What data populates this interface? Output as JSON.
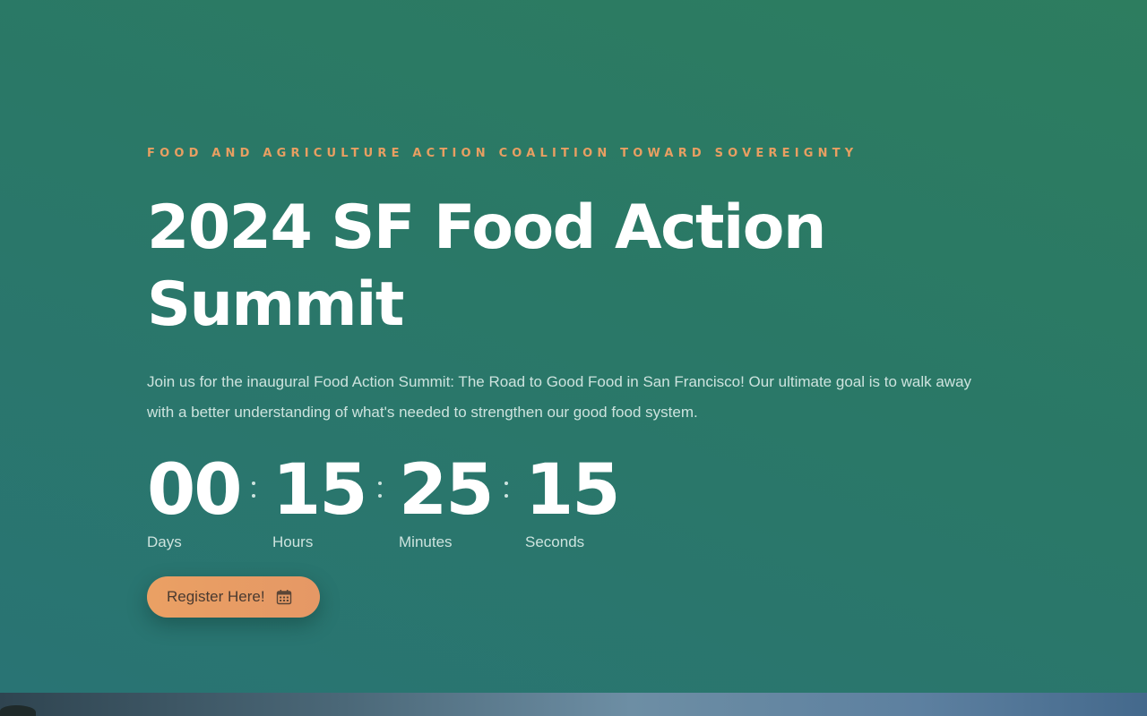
{
  "hero": {
    "eyebrow": "FOOD AND AGRICULTURE ACTION COALITION TOWARD SOVEREIGNTY",
    "title": "2024 SF Food Action Summit",
    "intro": "Join us for the inaugural Food Action Summit: The Road to Good Food in San Francisco! Our ultimate goal is to walk away with a better understanding of what's needed to strengthen our good food system."
  },
  "countdown": {
    "days": {
      "value": "00",
      "label": "Days"
    },
    "hours": {
      "value": "15",
      "label": "Hours"
    },
    "minutes": {
      "value": "25",
      "label": "Minutes"
    },
    "seconds": {
      "value": "15",
      "label": "Seconds"
    }
  },
  "register": {
    "label": "Register Here!",
    "icon": "calendar-icon"
  },
  "colors": {
    "accent": "#e89f62",
    "background": "#2a7867",
    "text": "#ffffff"
  }
}
